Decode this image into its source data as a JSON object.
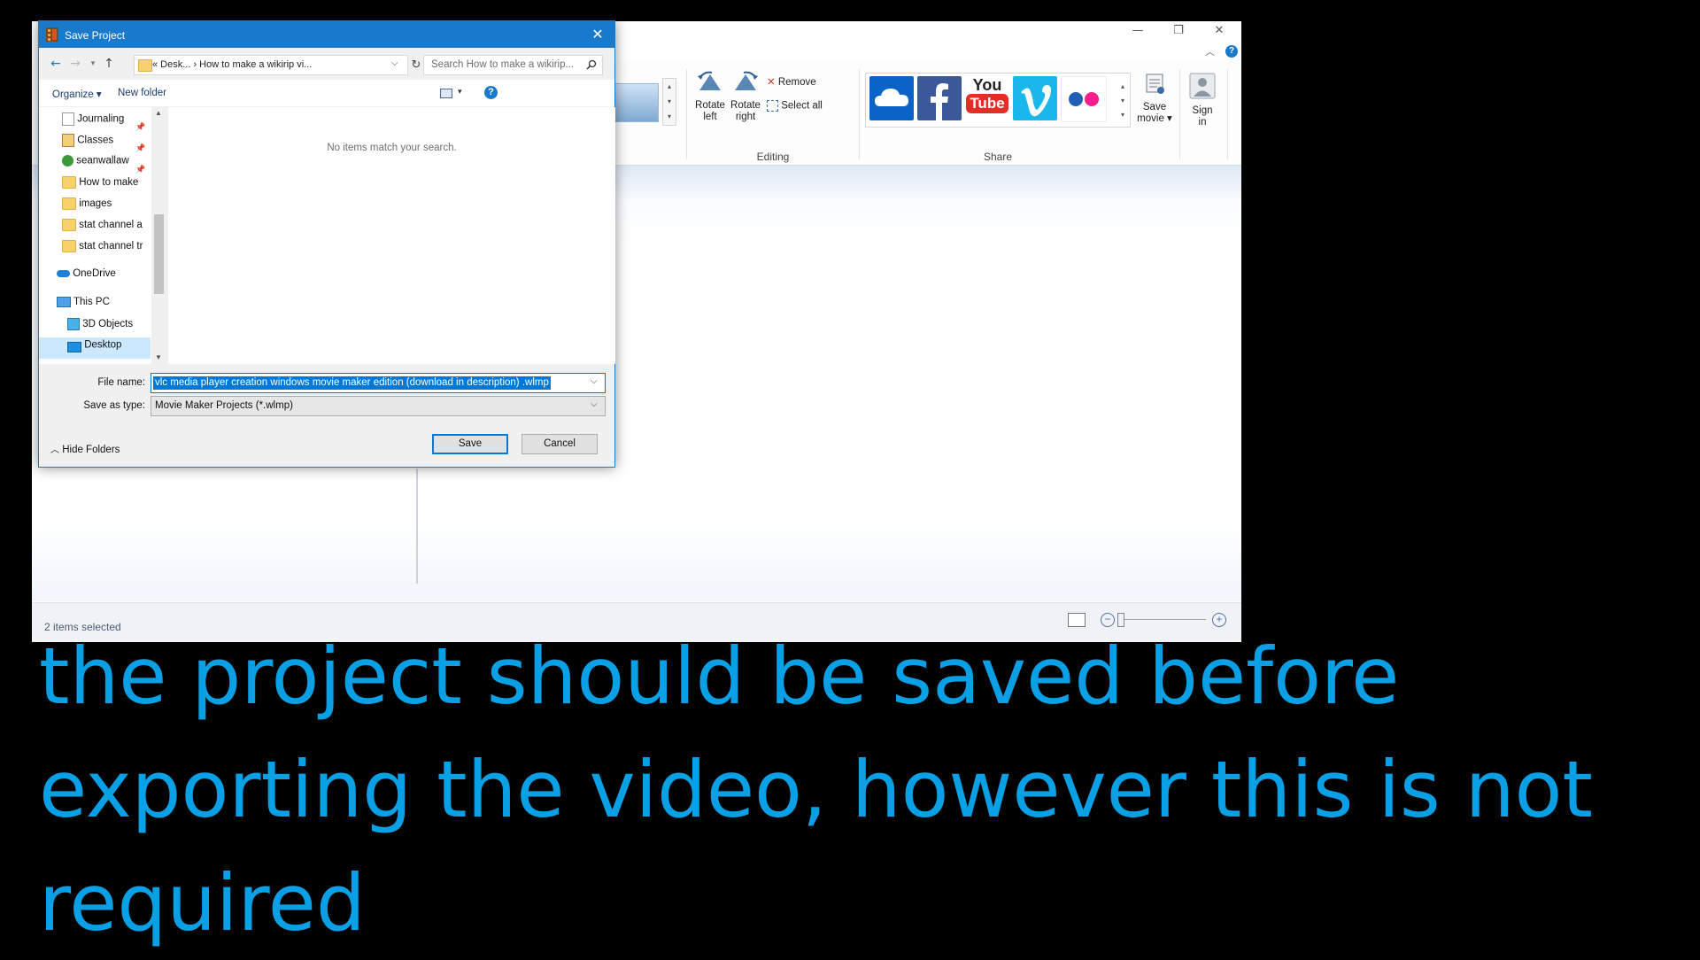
{
  "movie_maker": {
    "window_controls": {
      "minimize": "—",
      "restore": "❐",
      "close": "✕"
    },
    "editing": {
      "group_label": "Editing",
      "rotate_left": [
        "Rotate",
        "left"
      ],
      "rotate_right": [
        "Rotate",
        "right"
      ],
      "remove": "Remove",
      "select_all": "Select all"
    },
    "share": {
      "group_label": "Share",
      "services": [
        {
          "name": "onedrive-icon",
          "color": "#0a64c8"
        },
        {
          "name": "facebook-icon",
          "color": "#3b5998"
        },
        {
          "name": "youtube-icon",
          "color": "#ffffff"
        },
        {
          "name": "vimeo-icon",
          "color": "#1ab7ea"
        },
        {
          "name": "flickr-icon",
          "color": "#ffffff"
        }
      ],
      "youtube_text": [
        "You",
        "Tube"
      ]
    },
    "save_movie": [
      "Save",
      "movie ▾"
    ],
    "sign_in": [
      "Sign",
      "in"
    ],
    "status_text": "2 items selected"
  },
  "dialog": {
    "title": "Save Project",
    "address_path": "«  Desk...  ›  How to make a wikirip vi...",
    "search_placeholder": "Search How to make a wikirip...",
    "toolbar": {
      "organize": "Organize ▾",
      "new_folder": "New folder"
    },
    "nav_items": [
      {
        "label": "Journaling",
        "pinned": true
      },
      {
        "label": "Classes",
        "pinned": true
      },
      {
        "label": "seanwallaw",
        "pinned": true
      },
      {
        "label": "How to make",
        "pinned": false
      },
      {
        "label": "images",
        "pinned": false
      },
      {
        "label": "stat channel a",
        "pinned": false
      },
      {
        "label": "stat channel tr",
        "pinned": false
      }
    ],
    "onedrive": "OneDrive",
    "this_pc": "This PC",
    "objects_3d": "3D Objects",
    "desktop": "Desktop",
    "empty_message": "No items match your search.",
    "file_name_label": "File name:",
    "file_name_value": "vlc media player creation windows movie maker edition (download in description) .wlmp",
    "save_as_type_label": "Save as type:",
    "save_as_type_value": "Movie Maker Projects (*.wlmp)",
    "save_button": "Save",
    "cancel_button": "Cancel",
    "hide_folders": "Hide Folders"
  },
  "caption": "the project should be saved before exporting the video, however this is not required"
}
